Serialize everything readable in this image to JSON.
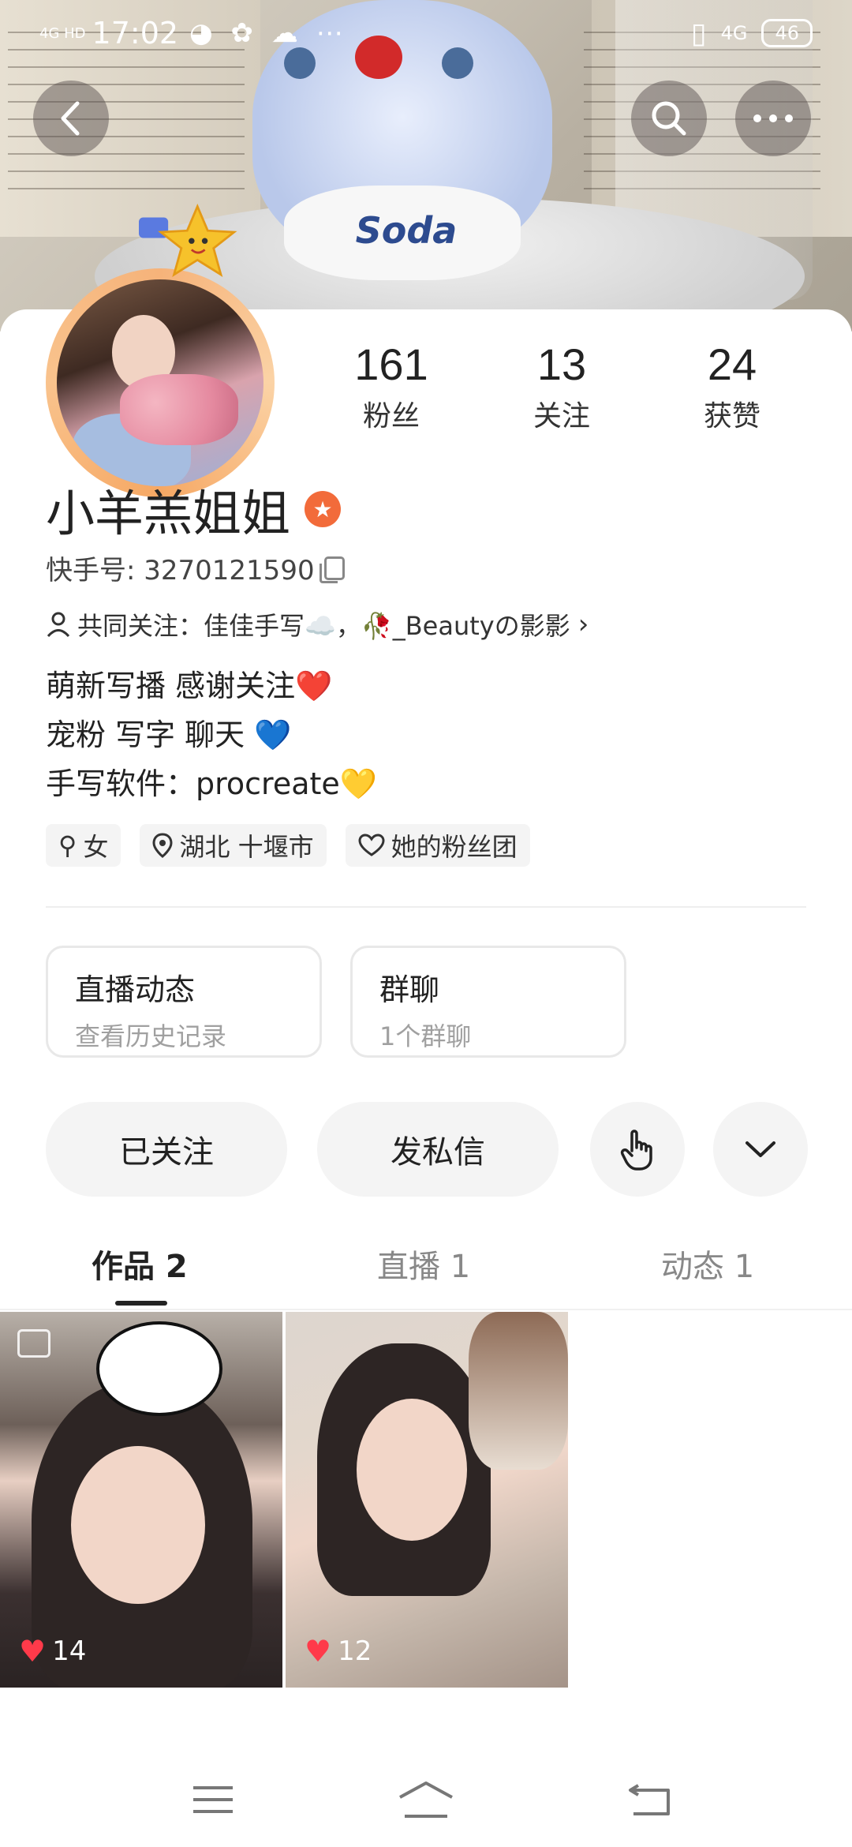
{
  "status_bar": {
    "network": "4G HD",
    "time": "17:02",
    "mobile_data": "4G",
    "battery": "46"
  },
  "profile": {
    "name": "小羊羔姐姐",
    "kuaishou_id": "快手号: 3270121590",
    "mutual_follow": "共同关注：佳佳手写☁️，🥀_Beautyの影影",
    "stats": [
      {
        "value": "161",
        "label": "粉丝"
      },
      {
        "value": "13",
        "label": "关注"
      },
      {
        "value": "24",
        "label": "获赞"
      }
    ],
    "bio_lines": [
      "萌新写播  感谢关注❤️",
      "宠粉  写字  聊天  💙",
      "手写软件：procreate💛"
    ],
    "tags": [
      "女",
      "湖北 十堰市",
      "她的粉丝团"
    ]
  },
  "banner": {
    "bib_text": "Soda"
  },
  "info_boxes": [
    {
      "title": "直播动态",
      "subtitle": "查看历史记录"
    },
    {
      "title": "群聊",
      "subtitle": "1个群聊"
    }
  ],
  "actions": {
    "followed_label": "已关注",
    "message_label": "发私信"
  },
  "tabs": [
    {
      "label": "作品 2",
      "active": true
    },
    {
      "label": "直播 1",
      "active": false
    },
    {
      "label": "动态 1",
      "active": false
    }
  ],
  "works": [
    {
      "likes": "14"
    },
    {
      "likes": "12"
    }
  ],
  "colors": {
    "accent_orange": "#f26b3a",
    "like_red": "#ff3a4a",
    "pill_bg": "#f4f4f4"
  },
  "icons": [
    "back-icon",
    "search-icon",
    "more-icon",
    "copy-icon",
    "person-icon",
    "chevron-right-icon",
    "gender-female-icon",
    "location-icon",
    "fan-club-icon",
    "tap-icon",
    "chevron-down-icon",
    "gallery-icon",
    "heart-icon",
    "menu-icon",
    "home-icon",
    "back-nav-icon"
  ]
}
